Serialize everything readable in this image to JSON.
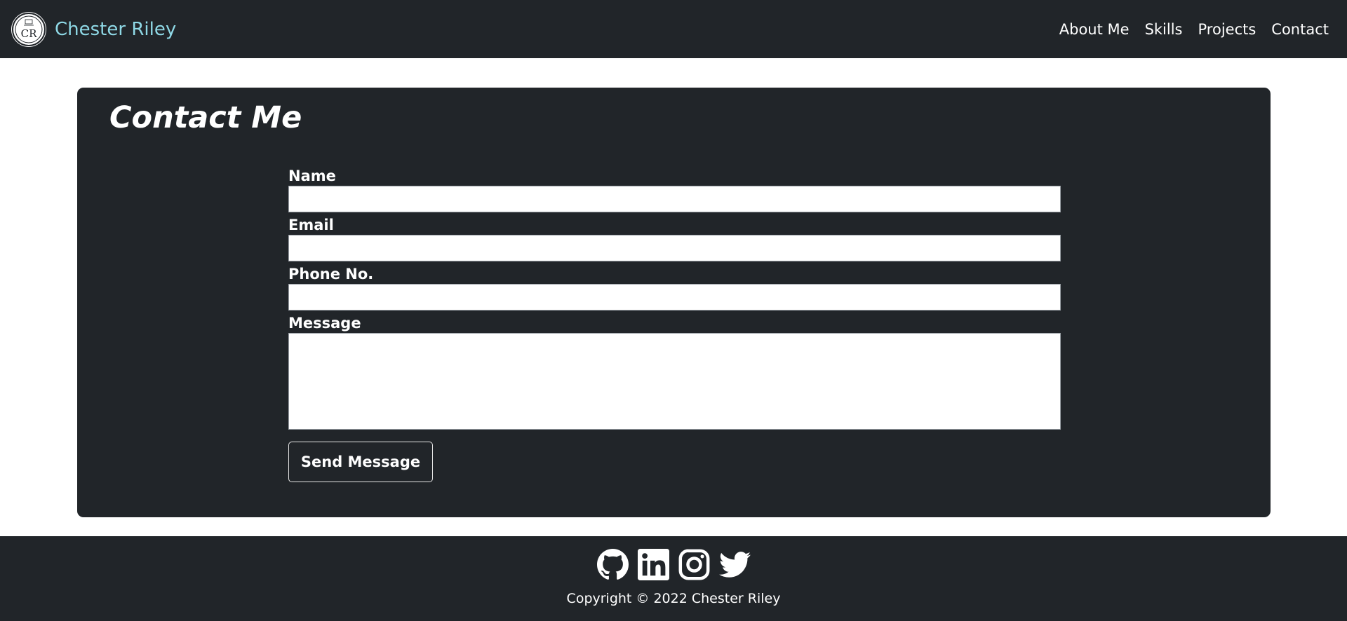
{
  "navbar": {
    "brand_logo_text": "CR",
    "brand_name": "Chester Riley",
    "links": [
      {
        "label": "About Me"
      },
      {
        "label": "Skills"
      },
      {
        "label": "Projects"
      },
      {
        "label": "Contact"
      }
    ]
  },
  "contact": {
    "title": "Contact Me",
    "fields": {
      "name": {
        "label": "Name",
        "value": "",
        "placeholder": ""
      },
      "email": {
        "label": "Email",
        "value": "",
        "placeholder": ""
      },
      "phone": {
        "label": "Phone No.",
        "value": "",
        "placeholder": ""
      },
      "message": {
        "label": "Message",
        "value": "",
        "placeholder": ""
      }
    },
    "submit_label": "Send Message"
  },
  "footer": {
    "social": [
      {
        "icon": "github-icon"
      },
      {
        "icon": "linkedin-icon"
      },
      {
        "icon": "instagram-icon"
      },
      {
        "icon": "twitter-icon"
      }
    ],
    "copyright": "Copyright © 2022 Chester Riley"
  },
  "colors": {
    "background_dark": "#212529",
    "brand_text": "#8fd9e6",
    "text_light": "#ffffff",
    "page_background": "#ffffff"
  }
}
